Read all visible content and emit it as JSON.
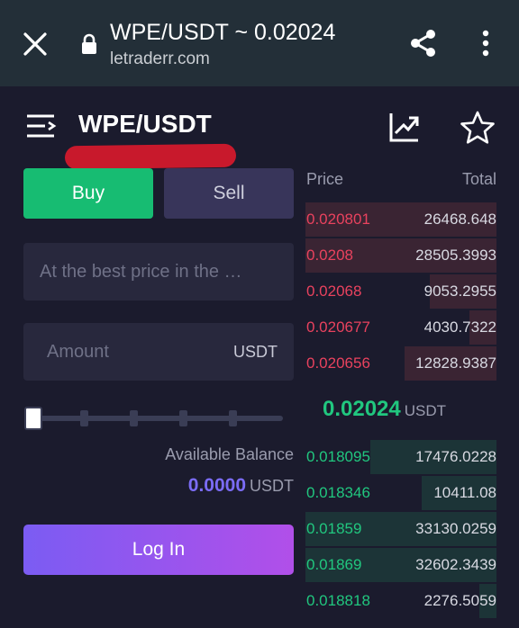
{
  "browser": {
    "title": "WPE/USDT ~ 0.02024",
    "domain": "letraderr.com"
  },
  "header": {
    "pair": "WPE/USDT"
  },
  "trade": {
    "buy_label": "Buy",
    "sell_label": "Sell",
    "price_placeholder": "At the best price in the …",
    "amount_placeholder": "Amount",
    "amount_unit": "USDT",
    "available_label": "Available Balance",
    "available_value": "0.0000",
    "available_unit": "USDT",
    "login_label": "Log In"
  },
  "orderbook": {
    "price_header": "Price",
    "total_header": "Total",
    "asks": [
      {
        "price": "0.020801",
        "total": "26468.648",
        "depth": 100
      },
      {
        "price": "0.0208",
        "total": "28505.3993",
        "depth": 100
      },
      {
        "price": "0.02068",
        "total": "9053.2955",
        "depth": 35
      },
      {
        "price": "0.020677",
        "total": "4030.7322",
        "depth": 14
      },
      {
        "price": "0.020656",
        "total": "12828.9387",
        "depth": 48
      }
    ],
    "last_price": "0.02024",
    "last_unit": "USDT",
    "bids": [
      {
        "price": "0.018095",
        "total": "17476.0228",
        "depth": 66
      },
      {
        "price": "0.018346",
        "total": "10411.08",
        "depth": 39
      },
      {
        "price": "0.01859",
        "total": "33130.0259",
        "depth": 100
      },
      {
        "price": "0.01869",
        "total": "32602.3439",
        "depth": 100
      },
      {
        "price": "0.018818",
        "total": "2276.5059",
        "depth": 9
      }
    ]
  },
  "colors": {
    "buy": "#17bc72",
    "sell_bg": "#38355a",
    "ask": "#e9425e",
    "bid": "#21c77f",
    "accent": "#7b6cf6"
  },
  "icons": [
    "close-icon",
    "lock-icon",
    "share-icon",
    "more-icon",
    "menu-icon",
    "chart-icon",
    "star-icon"
  ]
}
